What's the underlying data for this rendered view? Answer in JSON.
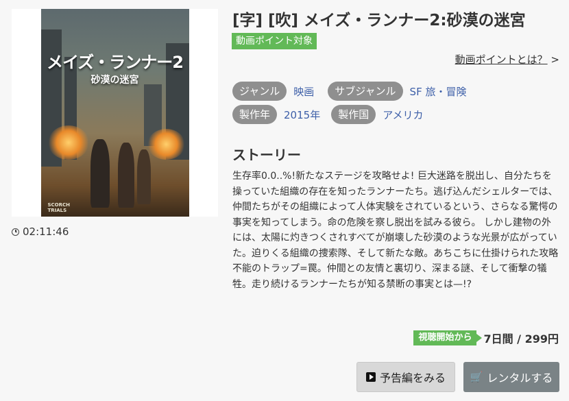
{
  "poster": {
    "title_art": "メイズ・ランナー2",
    "subtitle_art": "砂漠の迷宮",
    "logo_line1": "SCORCH",
    "logo_line2": "TRIALS"
  },
  "duration": "02:11:46",
  "title": "[字] [吹] メイズ・ランナー2:砂漠の迷宮",
  "point_badge": "動画ポイント対象",
  "point_link": {
    "label": "動画ポイントとは？",
    "arrow": ">"
  },
  "tags": {
    "genre_label": "ジャンル",
    "genre_value": "映画",
    "subgenre_label": "サブジャンル",
    "subgenre_value": "SF 旅・冒険",
    "year_label": "製作年",
    "year_value": "2015年",
    "country_label": "製作国",
    "country_value": "アメリカ"
  },
  "story": {
    "heading": "ストーリー",
    "text": "生存率0.0..%!新たなステージを攻略せよ! 巨大迷路を脱出し、自分たちを操っていた組織の存在を知ったランナーたち。逃げ込んだシェルターでは、仲間たちがその組織によって人体実験をされているという、さらなる驚愕の事実を知ってしまう。命の危険を察し脱出を試みる彼ら。 しかし建物の外には、太陽に灼きつくされすべてが崩壊した砂漠のような光景が広がっていた。迫りくる組織の捜索隊、そして新たな敵。あちこちに仕掛けられた攻略不能のトラップ=罠。仲間との友情と裏切り、深まる謎、そして衝撃の犠牲。走り続けるランナーたちが知る禁断の事実とは—!?"
  },
  "price": {
    "badge": "視聴開始から",
    "value": "7日間 / 299円"
  },
  "buttons": {
    "trailer": "予告編をみる",
    "rent": "レンタルする"
  },
  "colors": {
    "accent_green": "#62b957",
    "pill_gray": "#8f8f8f",
    "link_blue": "#3d5fa8",
    "rent_button": "#7a8386"
  }
}
